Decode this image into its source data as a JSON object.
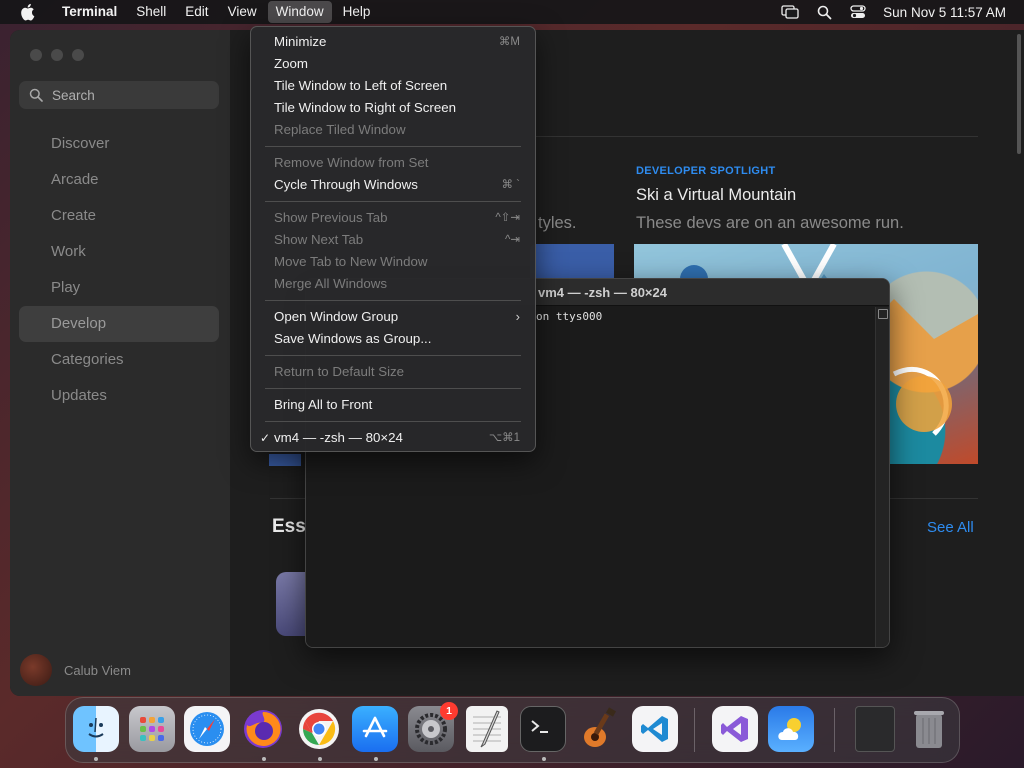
{
  "menubar": {
    "app_name": "Terminal",
    "items": [
      "Shell",
      "Edit",
      "View",
      "Window",
      "Help"
    ],
    "clock": "Sun Nov 5  11:57 AM"
  },
  "appstore": {
    "search_placeholder": "Search",
    "nav": [
      "Discover",
      "Arcade",
      "Create",
      "Work",
      "Play",
      "Develop",
      "Categories",
      "Updates"
    ],
    "selected_nav": "Develop",
    "user_name": "Calub Viem",
    "spotlight_kicker": "DEVELOPER SPOTLIGHT",
    "spotlight_title": "Ski a Virtual Mountain",
    "spotlight_subtitle": "These devs are on an awesome run.",
    "partial_subtitle": "tyles.",
    "section_title_partial": "Ess",
    "see_all": "See All"
  },
  "terminal": {
    "title": "vm4 — -zsh — 80×24",
    "line1": "on ttys000"
  },
  "window_menu": {
    "items": [
      {
        "label": "Minimize",
        "shortcut": "⌘M",
        "disabled": false
      },
      {
        "label": "Zoom",
        "shortcut": "",
        "disabled": false
      },
      {
        "label": "Tile Window to Left of Screen",
        "shortcut": "",
        "disabled": false
      },
      {
        "label": "Tile Window to Right of Screen",
        "shortcut": "",
        "disabled": false
      },
      {
        "label": "Replace Tiled Window",
        "shortcut": "",
        "disabled": true
      },
      {
        "label": "Remove Window from Set",
        "shortcut": "",
        "disabled": true
      },
      {
        "label": "Cycle Through Windows",
        "shortcut": "⌘ `",
        "disabled": false
      },
      {
        "label": "Show Previous Tab",
        "shortcut": "^⇧⇥",
        "disabled": true
      },
      {
        "label": "Show Next Tab",
        "shortcut": "^⇥",
        "disabled": true
      },
      {
        "label": "Move Tab to New Window",
        "shortcut": "",
        "disabled": true
      },
      {
        "label": "Merge All Windows",
        "shortcut": "",
        "disabled": true
      },
      {
        "label": "Open Window Group",
        "shortcut": "",
        "disabled": false
      },
      {
        "label": "Save Windows as Group...",
        "shortcut": "",
        "disabled": false
      },
      {
        "label": "Return to Default Size",
        "shortcut": "",
        "disabled": true
      },
      {
        "label": "Bring All to Front",
        "shortcut": "",
        "disabled": false
      },
      {
        "label": "vm4 — -zsh — 80×24",
        "shortcut": "⌥⌘1",
        "disabled": false
      }
    ]
  },
  "dock": {
    "apps": [
      "Finder",
      "Launchpad",
      "Safari",
      "Firefox",
      "Chrome",
      "App Store",
      "System Settings",
      "TextEdit",
      "Terminal",
      "GarageBand",
      "Visual Studio Code",
      "Visual Studio",
      "Weather",
      "Downloads",
      "Trash"
    ],
    "settings_badge": "1"
  },
  "colors": {
    "accent": "#2e8cf0",
    "badge": "#ff3b30"
  }
}
